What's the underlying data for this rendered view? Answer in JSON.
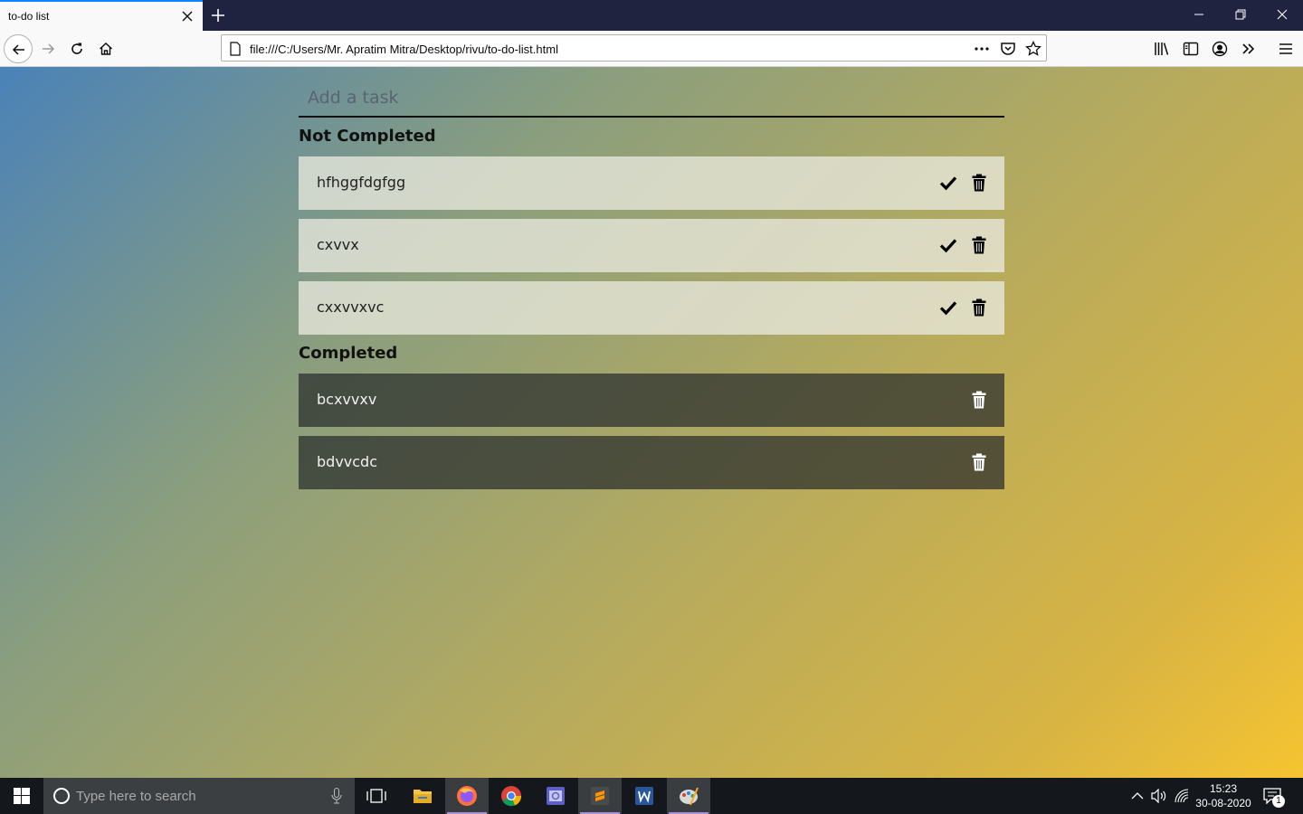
{
  "browser": {
    "tab_title": "to-do list",
    "url": "file:///C:/Users/Mr. Apratim Mitra/Desktop/rivu/to-do-list.html"
  },
  "app": {
    "input_placeholder": "Add a task",
    "not_completed_title": "Not Completed",
    "completed_title": "Completed",
    "not_completed": [
      {
        "text": "hfhggfdgfgg"
      },
      {
        "text": "cxvvx"
      },
      {
        "text": "cxxvvxvc"
      }
    ],
    "completed": [
      {
        "text": "bcxvvxv"
      },
      {
        "text": "bdvvcdc"
      }
    ]
  },
  "taskbar": {
    "search_placeholder": "Type here to search",
    "time": "15:23",
    "date": "30-08-2020",
    "notification_count": "1"
  },
  "colors": {
    "gradient_start": "#4a82b8",
    "gradient_end": "#f6c431",
    "todo_bg": "#e8e8dc",
    "done_bg": "#282d2d"
  }
}
